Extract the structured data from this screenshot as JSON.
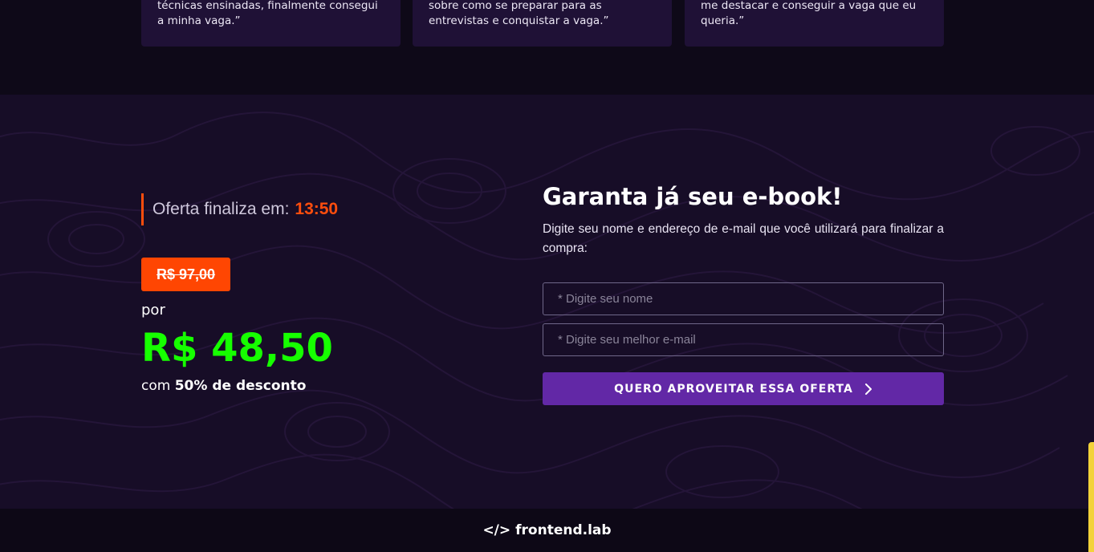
{
  "testimonials": [
    {
      "text": "técnicas ensinadas, finalmente consegui a minha vaga.”"
    },
    {
      "text": "sobre como se preparar para as entrevistas e conquistar a vaga.”"
    },
    {
      "text": "me destacar e conseguir a vaga que eu queria.”"
    }
  ],
  "offer": {
    "timer_label": "Oferta finaliza em:",
    "timer_value": "13:50",
    "old_price": "R$ 97,00",
    "por": "por",
    "new_price": "R$ 48,50",
    "discount_prefix": "com",
    "discount_bold": "50% de desconto"
  },
  "form": {
    "title": "Garanta já seu e-book!",
    "description": "Digite seu nome e endereço de e-mail que você utilizará para finalizar a compra:",
    "name_placeholder": "* Digite seu nome",
    "email_placeholder": "* Digite seu melhor e-mail",
    "submit_label": "QUERO APROVEITAR ESSA OFERTA"
  },
  "footer": {
    "logo_symbol": "</>",
    "logo_text": "frontend.lab"
  },
  "colors": {
    "accent_orange": "#ff4d0d",
    "price_green": "#16ff00",
    "button_purple": "#6228a6",
    "section_bg": "#170d27",
    "scroll_indicator": "#f3d23a"
  }
}
